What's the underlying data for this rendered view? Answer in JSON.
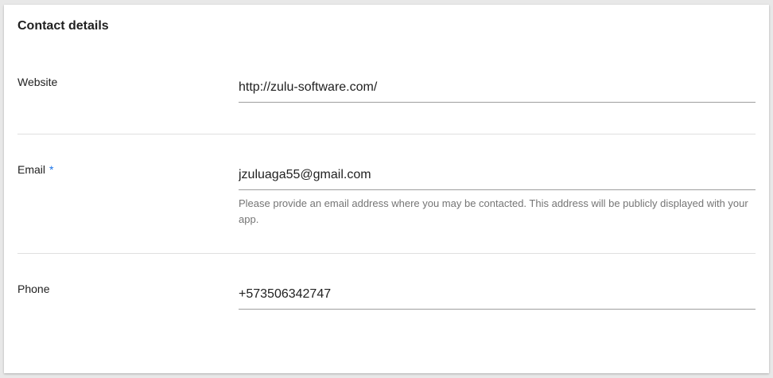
{
  "section": {
    "title": "Contact details"
  },
  "fields": {
    "website": {
      "label": "Website",
      "value": "http://zulu-software.com/"
    },
    "email": {
      "label": "Email",
      "required_mark": "*",
      "value": "jzuluaga55@gmail.com",
      "helper": "Please provide an email address where you may be contacted. This address will be publicly displayed with your app."
    },
    "phone": {
      "label": "Phone",
      "value": "+573506342747"
    }
  },
  "colors": {
    "required_accent": "#1a73e8",
    "underline": "#9e9e9e",
    "divider": "#e0e0e0",
    "helper_text": "#757575"
  }
}
